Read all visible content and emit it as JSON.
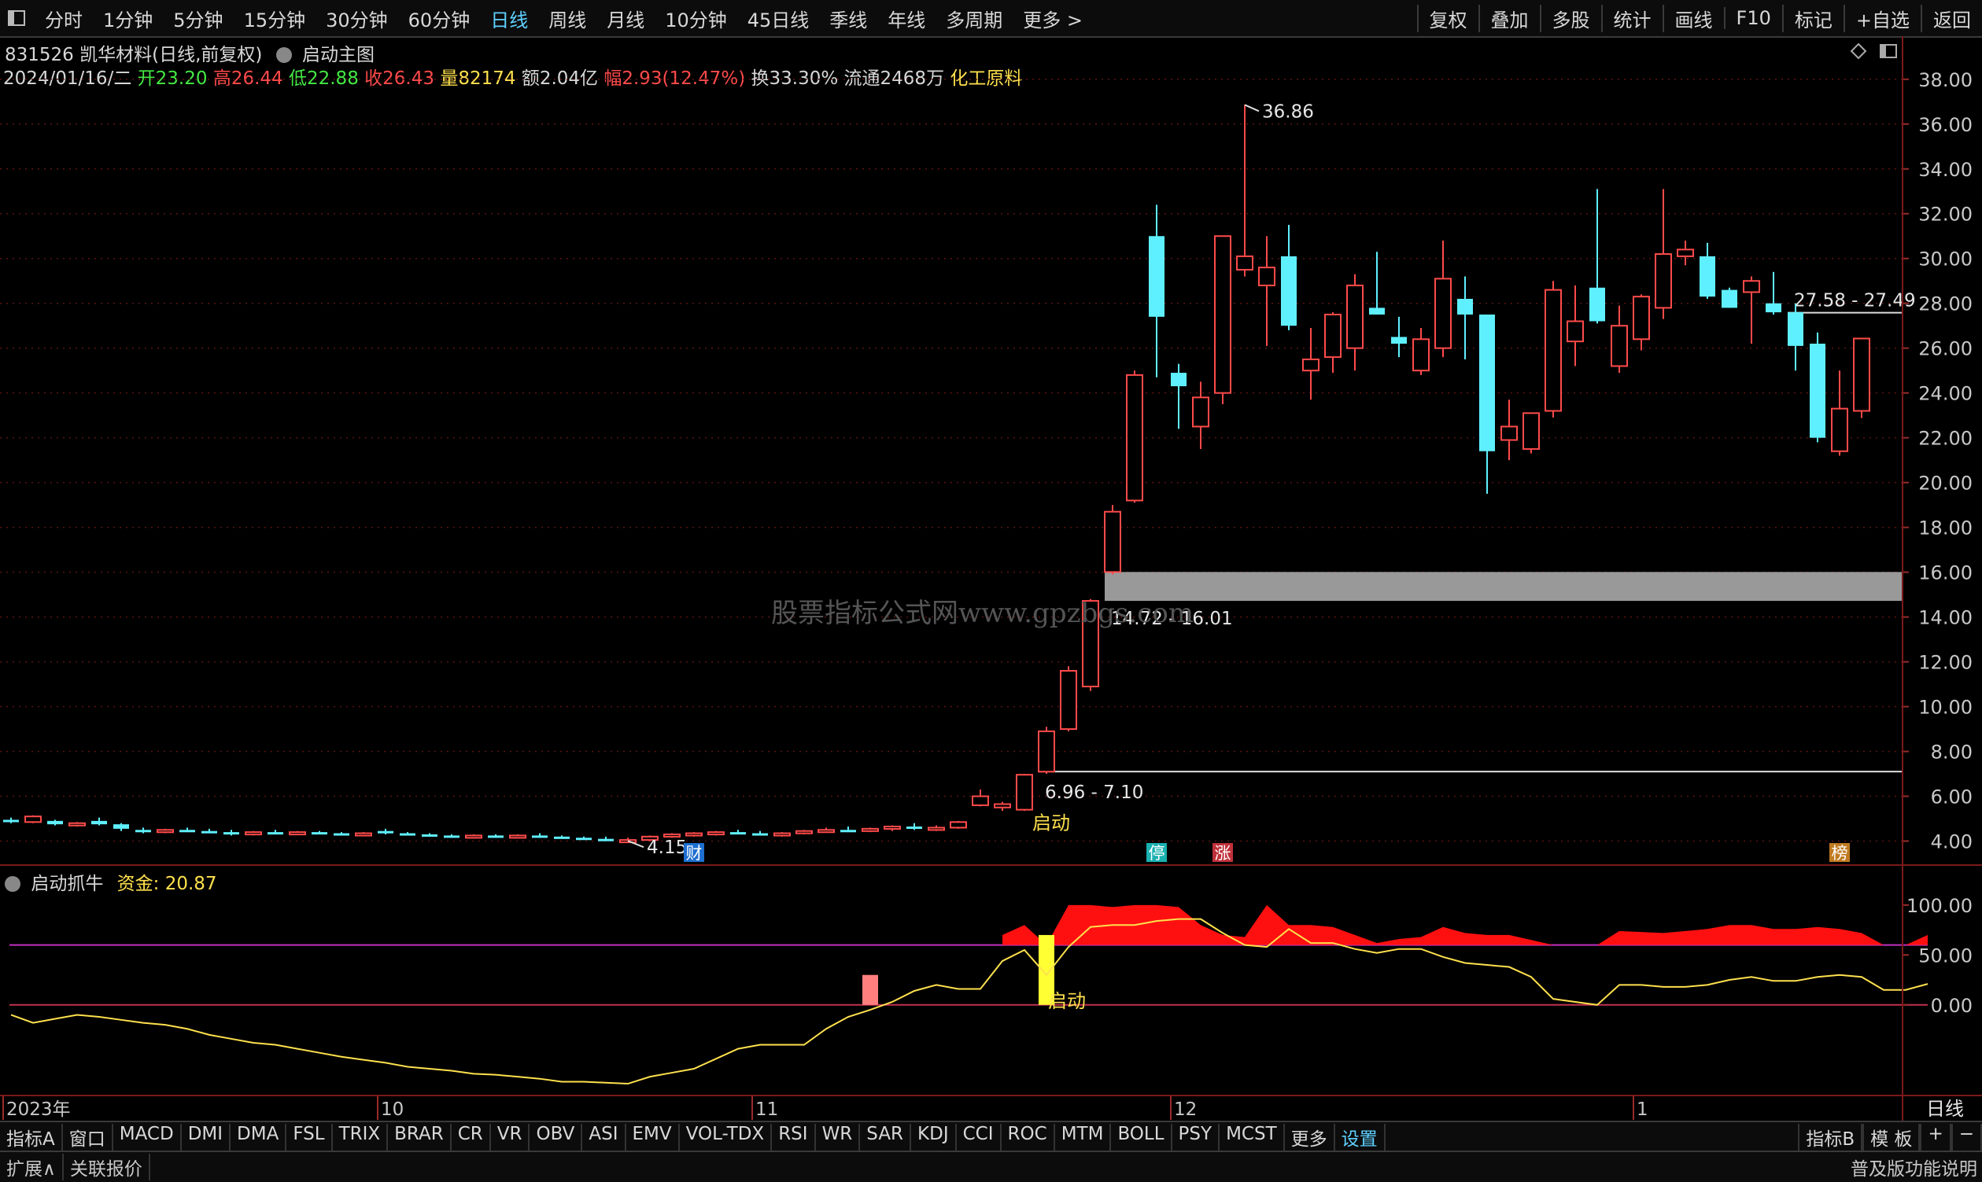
{
  "toolbar": {
    "periods": [
      "分时",
      "1分钟",
      "5分钟",
      "15分钟",
      "30分钟",
      "60分钟",
      "日线",
      "周线",
      "月线",
      "10分钟",
      "45日线",
      "季线",
      "年线",
      "多周期",
      "更多 >"
    ],
    "active_period": "日线",
    "right_buttons": [
      "复权",
      "叠加",
      "多股",
      "统计",
      "画线",
      "F10",
      "标记",
      "+自选",
      "返回"
    ]
  },
  "stock": {
    "code_name": "831526 凯华材料(日线,前复权)",
    "indicator_name": "启动主图",
    "date": "2024/01/16/二",
    "open_label": "开",
    "open": "23.20",
    "high_label": "高",
    "high": "26.44",
    "low_label": "低",
    "low": "22.88",
    "close_label": "收",
    "close": "26.43",
    "vol_label": "量",
    "vol": "82174",
    "amount_label": "额",
    "amount": "2.04亿",
    "change_label": "幅",
    "change": "2.93(12.47%)",
    "turnover": "换33.30%",
    "float": "流通2468万",
    "sector": "化工原料"
  },
  "colors": {
    "up": "#ff4a4a",
    "down": "#5ff0ff",
    "ma": "#ffe14d",
    "zone": "#999999",
    "grid": "#6a1a1a"
  },
  "chart_data": [
    {
      "type": "candlestick",
      "title": "831526 凯华材料(日线,前复权)",
      "y_ticks": [
        "38.00",
        "36.00",
        "34.00",
        "32.00",
        "30.00",
        "28.00",
        "26.00",
        "24.00",
        "22.00",
        "20.00",
        "18.00",
        "16.00",
        "14.00",
        "12.00",
        "10.00",
        "8.00",
        "6.00",
        "4.00"
      ],
      "ylim": [
        3.0,
        38.8
      ],
      "x_ticks": [
        {
          "label": "2023年",
          "idx": 0
        },
        {
          "label": "10",
          "idx": 17
        },
        {
          "label": "11",
          "idx": 34
        },
        {
          "label": "12",
          "idx": 53
        },
        {
          "label": "1",
          "idx": 74
        }
      ],
      "candles": [
        [
          4.95,
          5.05,
          4.8,
          4.85
        ],
        [
          4.85,
          5.15,
          4.8,
          5.1
        ],
        [
          4.9,
          4.95,
          4.7,
          4.75
        ],
        [
          4.75,
          4.85,
          4.65,
          4.8
        ],
        [
          4.9,
          5.05,
          4.7,
          4.75
        ],
        [
          4.75,
          4.8,
          4.45,
          4.55
        ],
        [
          4.5,
          4.6,
          4.35,
          4.45
        ],
        [
          4.45,
          4.55,
          4.35,
          4.5
        ],
        [
          4.5,
          4.6,
          4.4,
          4.45
        ],
        [
          4.45,
          4.55,
          4.35,
          4.4
        ],
        [
          4.4,
          4.5,
          4.25,
          4.3
        ],
        [
          4.3,
          4.45,
          4.25,
          4.4
        ],
        [
          4.4,
          4.5,
          4.3,
          4.35
        ],
        [
          4.35,
          4.45,
          4.3,
          4.4
        ],
        [
          4.4,
          4.45,
          4.3,
          4.35
        ],
        [
          4.35,
          4.4,
          4.25,
          4.3
        ],
        [
          4.3,
          4.4,
          4.25,
          4.35
        ],
        [
          4.45,
          4.55,
          4.3,
          4.35
        ],
        [
          4.35,
          4.4,
          4.25,
          4.3
        ],
        [
          4.3,
          4.35,
          4.2,
          4.25
        ],
        [
          4.25,
          4.3,
          4.15,
          4.2
        ],
        [
          4.2,
          4.3,
          4.15,
          4.25
        ],
        [
          4.25,
          4.3,
          4.15,
          4.2
        ],
        [
          4.2,
          4.3,
          4.15,
          4.25
        ],
        [
          4.25,
          4.35,
          4.15,
          4.2
        ],
        [
          4.2,
          4.25,
          4.1,
          4.15
        ],
        [
          4.15,
          4.2,
          4.05,
          4.1
        ],
        [
          4.1,
          4.2,
          4.05,
          4.05
        ],
        [
          4.05,
          4.15,
          3.95,
          4.05
        ],
        [
          4.05,
          4.25,
          4.0,
          4.2
        ],
        [
          4.2,
          4.35,
          4.15,
          4.3
        ],
        [
          4.3,
          4.4,
          4.2,
          4.35
        ],
        [
          4.35,
          4.45,
          4.25,
          4.4
        ],
        [
          4.4,
          4.5,
          4.3,
          4.35
        ],
        [
          4.35,
          4.45,
          4.25,
          4.3
        ],
        [
          4.3,
          4.4,
          4.2,
          4.35
        ],
        [
          4.35,
          4.5,
          4.3,
          4.45
        ],
        [
          4.45,
          4.6,
          4.4,
          4.5
        ],
        [
          4.5,
          4.65,
          4.4,
          4.45
        ],
        [
          4.45,
          4.6,
          4.4,
          4.55
        ],
        [
          4.55,
          4.7,
          4.45,
          4.65
        ],
        [
          4.65,
          4.8,
          4.5,
          4.55
        ],
        [
          4.55,
          4.7,
          4.45,
          4.6
        ],
        [
          4.6,
          4.9,
          4.55,
          4.85
        ],
        [
          5.6,
          6.3,
          5.55,
          6.0
        ],
        [
          5.5,
          5.75,
          5.35,
          5.65
        ],
        [
          5.4,
          7.0,
          5.35,
          6.96
        ],
        [
          7.1,
          9.1,
          7.0,
          8.9
        ],
        [
          9.0,
          11.8,
          8.9,
          11.6
        ],
        [
          10.9,
          14.8,
          10.7,
          14.72
        ],
        [
          16.01,
          19.0,
          15.9,
          18.7
        ],
        [
          19.2,
          25.0,
          19.1,
          24.8
        ],
        [
          31.0,
          32.4,
          24.7,
          27.4
        ],
        [
          24.9,
          25.3,
          22.4,
          24.3
        ],
        [
          22.5,
          24.5,
          21.5,
          23.8
        ],
        [
          24.0,
          30.9,
          23.5,
          31.0
        ],
        [
          29.5,
          36.86,
          29.2,
          30.1
        ],
        [
          28.8,
          31.0,
          26.1,
          29.6
        ],
        [
          30.1,
          31.5,
          26.8,
          27.0
        ],
        [
          25.0,
          26.9,
          23.7,
          25.5
        ],
        [
          25.6,
          27.6,
          24.9,
          27.5
        ],
        [
          26.0,
          29.3,
          25.0,
          28.8
        ],
        [
          27.8,
          30.3,
          27.5,
          27.5
        ],
        [
          26.5,
          27.4,
          25.6,
          26.2
        ],
        [
          25.0,
          26.9,
          24.8,
          26.4
        ],
        [
          26.0,
          30.8,
          25.6,
          29.1
        ],
        [
          28.2,
          29.2,
          25.5,
          27.5
        ],
        [
          27.5,
          26.9,
          19.5,
          21.4
        ],
        [
          21.9,
          23.7,
          21.0,
          22.5
        ],
        [
          21.5,
          22.8,
          21.3,
          23.1
        ],
        [
          23.2,
          29.0,
          22.9,
          28.6
        ],
        [
          26.3,
          28.8,
          25.2,
          27.2
        ],
        [
          28.7,
          33.1,
          27.1,
          27.2
        ],
        [
          25.2,
          27.9,
          24.9,
          27.0
        ],
        [
          26.4,
          28.4,
          25.9,
          28.3
        ],
        [
          27.8,
          33.1,
          27.3,
          30.2
        ],
        [
          30.1,
          30.8,
          29.7,
          30.4
        ],
        [
          30.1,
          30.7,
          28.2,
          28.3
        ],
        [
          28.6,
          28.7,
          27.8,
          27.8
        ],
        [
          28.5,
          29.2,
          26.2,
          29.0
        ],
        [
          28.0,
          29.4,
          27.5,
          27.6
        ],
        [
          27.6,
          28.0,
          25.0,
          26.1
        ],
        [
          26.2,
          26.7,
          21.8,
          22.0
        ],
        [
          21.4,
          25.0,
          21.2,
          23.3
        ],
        [
          23.2,
          26.44,
          22.88,
          26.43
        ]
      ],
      "zones": [
        {
          "range": "14.72 - 16.01",
          "low": 14.72,
          "high": 16.01,
          "start": 49
        },
        {
          "range": "6.96 - 7.10",
          "low": 6.96,
          "high": 7.1,
          "start": 46
        },
        {
          "range": "27.58 - 27.49",
          "low": 27.49,
          "high": 27.58,
          "start": 80
        }
      ],
      "annotations": [
        {
          "text": "36.86",
          "type": "max",
          "idx": 56,
          "value": 36.86
        },
        {
          "text": "4.15",
          "type": "min",
          "idx": 28,
          "value": 4.15
        },
        {
          "text": "启动",
          "idx": 46,
          "value": 5.4
        }
      ],
      "event_markers": [
        {
          "text": "财",
          "idx": 31,
          "color": "#1e6fd0"
        },
        {
          "text": "停",
          "idx": 52,
          "color": "#1ab0b0"
        },
        {
          "text": "涨",
          "idx": 55,
          "color": "#c0303a"
        },
        {
          "text": "榜",
          "idx": 83,
          "color": "#c07a20"
        }
      ]
    },
    {
      "type": "area",
      "title": "启动抓牛",
      "series_label": "资金",
      "current_value": "20.87",
      "y_ticks": [
        "100.00",
        "50.00",
        "0.00"
      ],
      "ylim": [
        -90,
        118
      ],
      "h_lines": [
        {
          "value": 60,
          "color": "#c030c0"
        },
        {
          "value": 0,
          "color": "#c03050"
        }
      ],
      "line_series": [
        -10,
        -18,
        -14,
        -10,
        -12,
        -15,
        -18,
        -20,
        -24,
        -30,
        -34,
        -38,
        -40,
        -44,
        -48,
        -52,
        -55,
        -58,
        -62,
        -64,
        -66,
        -69,
        -70,
        -72,
        -74,
        -77,
        -77,
        -78,
        -79,
        -72,
        -68,
        -64,
        -54,
        -44,
        -40,
        -40,
        -40,
        -24,
        -12,
        -5,
        3,
        14,
        20,
        16,
        16,
        44,
        55,
        30,
        58,
        78,
        80,
        80,
        84,
        86,
        86,
        72,
        60,
        58,
        76,
        62,
        62,
        56,
        52,
        56,
        56,
        48,
        42,
        40,
        38,
        28,
        6,
        3,
        0,
        20,
        20,
        18,
        18,
        20,
        25,
        28,
        24,
        24,
        28,
        30,
        28,
        15,
        15,
        21
      ],
      "red_area_top": [
        null,
        null,
        null,
        null,
        null,
        null,
        null,
        null,
        null,
        null,
        null,
        null,
        null,
        null,
        null,
        null,
        null,
        null,
        null,
        null,
        null,
        null,
        null,
        null,
        null,
        null,
        null,
        null,
        null,
        null,
        null,
        null,
        null,
        null,
        null,
        null,
        null,
        null,
        null,
        null,
        null,
        null,
        null,
        null,
        null,
        70,
        80,
        60,
        100,
        100,
        98,
        100,
        100,
        98,
        80,
        70,
        68,
        100,
        80,
        80,
        78,
        70,
        62,
        66,
        68,
        78,
        72,
        70,
        70,
        65,
        60,
        60,
        60,
        74,
        73,
        72,
        74,
        76,
        80,
        80,
        76,
        76,
        78,
        76,
        72,
        60,
        60,
        70
      ],
      "bars": [
        {
          "idx": 39,
          "from": 0,
          "to": 30,
          "color": "#ff7f7f"
        },
        {
          "idx": 47,
          "from": 0,
          "to": 70,
          "color": "#ffff33"
        }
      ],
      "annotations": [
        {
          "text": "启动",
          "idx": 47
        }
      ]
    }
  ],
  "period_label": "日线",
  "bottom_tabs": [
    "指标A",
    "窗口",
    "MACD",
    "DMI",
    "DMA",
    "FSL",
    "TRIX",
    "BRAR",
    "CR",
    "VR",
    "OBV",
    "ASI",
    "EMV",
    "VOL-TDX",
    "RSI",
    "WR",
    "SAR",
    "KDJ",
    "CCI",
    "ROC",
    "MTM",
    "BOLL",
    "PSY",
    "MCST",
    "更多",
    "设置"
  ],
  "bottom_right": [
    "指标B",
    "模 板",
    "+",
    "−"
  ],
  "status": {
    "left1": "扩展∧",
    "left2": "关联报价",
    "right": "普及版功能说明"
  },
  "watermark": "股票指标公式网www.gpzbgs.com"
}
